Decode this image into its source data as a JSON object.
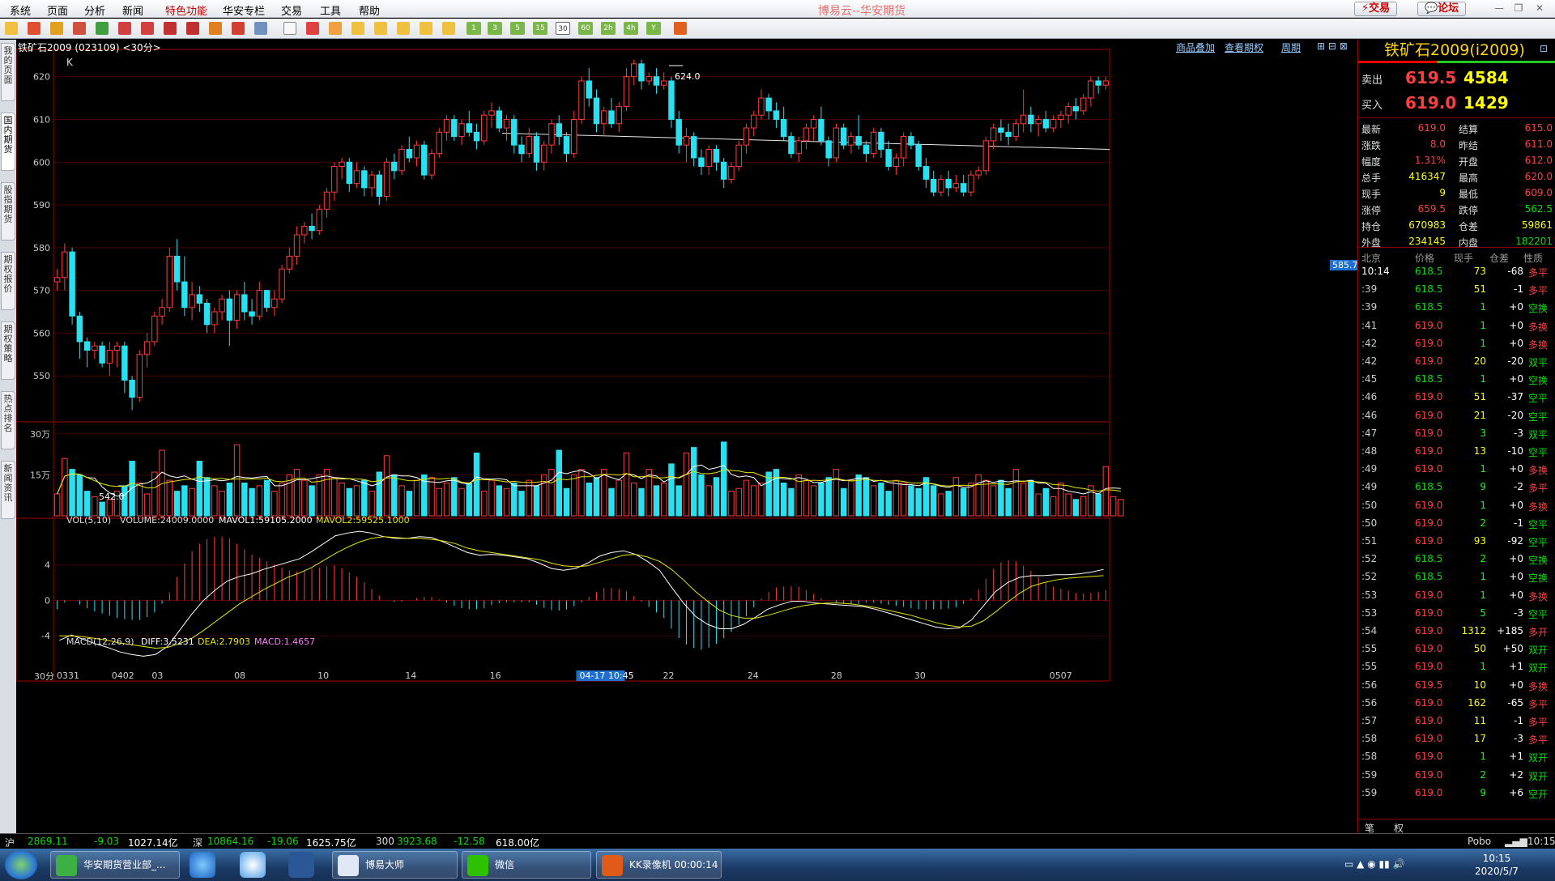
{
  "app": {
    "title": "博易云--华安期货",
    "menu": [
      "系统",
      "页面",
      "分析",
      "新闻",
      "特色功能",
      "华安专栏",
      "交易",
      "工具",
      "帮助"
    ],
    "trade_btn": "⚡交易",
    "forum_btn": "💬论坛"
  },
  "toolbar": {
    "period_buttons": [
      "1",
      "3",
      "5",
      "15",
      "30",
      "60",
      "2h",
      "4h",
      "Y"
    ],
    "selected": "30"
  },
  "sidetabs": [
    "我的页面",
    "国内期货",
    "股指期货",
    "期权报价",
    "期权策略",
    "热点排名",
    "新闻资讯"
  ],
  "chart": {
    "header_left": "铁矿石2009 (023109) <30分>",
    "header_links": [
      "商品叠加",
      "查看期权",
      "周期"
    ],
    "k_label": "K",
    "high_label": "624.0",
    "low_label": "542.0",
    "cursor_price": "585.7",
    "vol_header": {
      "name": "VOL(5,10)",
      "volume": "VOLUME:24009.0000",
      "mavol1": "MAVOL1:59105.2000",
      "mavol2": "MAVOL2:59525.1000"
    },
    "macd_header": {
      "name": "MACD(12,26,9)",
      "diff": "DIFF:3.5231",
      "dea": "DEA:2.7903",
      "macd": "MACD:1.4657"
    },
    "price_ticks": [
      "620",
      "610",
      "600",
      "590",
      "580",
      "570",
      "560",
      "550"
    ],
    "vol_ticks": [
      "30万",
      "15万"
    ],
    "macd_ticks": [
      "4",
      "0",
      "-4"
    ],
    "period_label": "30分",
    "date_labels": [
      "0331",
      "0402",
      "03",
      "08",
      "10",
      "14",
      "16",
      "04-17 10:45",
      "22",
      "24",
      "28",
      "30",
      "0507"
    ],
    "colors": {
      "up": "#ff3b3b",
      "down": "#28e0f0",
      "mavol1": "#ffffff",
      "mavol2": "#e6e600",
      "diff": "#ffffff",
      "dea": "#e6e600"
    }
  },
  "chart_data": {
    "type": "candlestick",
    "title": "铁矿石2009 (023109) <30分>",
    "ylim": [
      540,
      626
    ],
    "trendline": [
      [
        609.5,
        1
      ],
      [
        606,
        76
      ]
    ],
    "candles": [
      [
        572,
        575,
        570,
        573
      ],
      [
        573,
        581,
        570,
        579
      ],
      [
        579,
        580,
        562,
        564
      ],
      [
        564,
        565,
        554,
        558
      ],
      [
        558,
        559,
        552,
        556
      ],
      [
        556,
        558,
        554,
        557
      ],
      [
        557,
        558,
        552,
        553
      ],
      [
        553,
        558,
        550,
        556
      ],
      [
        556,
        558,
        552,
        557
      ],
      [
        557,
        558,
        546,
        549
      ],
      [
        549,
        550,
        542,
        545
      ],
      [
        545,
        556,
        544,
        555
      ],
      [
        555,
        560,
        552,
        558
      ],
      [
        558,
        565,
        557,
        564
      ],
      [
        564,
        568,
        562,
        566
      ],
      [
        566,
        580,
        565,
        578
      ],
      [
        578,
        582,
        570,
        572
      ],
      [
        572,
        578,
        564,
        566
      ],
      [
        566,
        572,
        563,
        569
      ],
      [
        569,
        571,
        565,
        567
      ],
      [
        567,
        568,
        560,
        562
      ],
      [
        562,
        566,
        560,
        565
      ],
      [
        565,
        569,
        563,
        568
      ],
      [
        568,
        570,
        557,
        563
      ],
      [
        563,
        570,
        561,
        569
      ],
      [
        569,
        572,
        563,
        565
      ],
      [
        565,
        568,
        562,
        564
      ],
      [
        564,
        572,
        563,
        570
      ],
      [
        570,
        570,
        565,
        566
      ],
      [
        566,
        570,
        564,
        568
      ],
      [
        568,
        576,
        567,
        575
      ],
      [
        575,
        580,
        574,
        578
      ],
      [
        578,
        585,
        576,
        583
      ],
      [
        583,
        586,
        581,
        585
      ],
      [
        585,
        588,
        582,
        584
      ],
      [
        584,
        590,
        583,
        589
      ],
      [
        589,
        594,
        587,
        593
      ],
      [
        593,
        600,
        591,
        599
      ],
      [
        599,
        601,
        596,
        600
      ],
      [
        600,
        601,
        593,
        595
      ],
      [
        595,
        600,
        594,
        598
      ],
      [
        598,
        599,
        592,
        594
      ],
      [
        594,
        598,
        592,
        597
      ],
      [
        597,
        598,
        590,
        592
      ],
      [
        592,
        601,
        591,
        600
      ],
      [
        600,
        602,
        596,
        598
      ],
      [
        598,
        604,
        597,
        603
      ],
      [
        603,
        606,
        600,
        601
      ],
      [
        601,
        605,
        599,
        604
      ],
      [
        604,
        605,
        596,
        597
      ],
      [
        597,
        603,
        596,
        602
      ],
      [
        602,
        608,
        601,
        607
      ],
      [
        607,
        611,
        605,
        610
      ],
      [
        610,
        611,
        605,
        606
      ],
      [
        606,
        610,
        604,
        609
      ],
      [
        609,
        612,
        606,
        607
      ],
      [
        607,
        609,
        603,
        605
      ],
      [
        605,
        612,
        604,
        611
      ],
      [
        611,
        614,
        608,
        612
      ],
      [
        612,
        613,
        607,
        608
      ],
      [
        608,
        611,
        605,
        610
      ],
      [
        610,
        611,
        602,
        604
      ],
      [
        604,
        606,
        600,
        602
      ],
      [
        602,
        608,
        601,
        606
      ],
      [
        606,
        607,
        598,
        600
      ],
      [
        600,
        605,
        598,
        604
      ],
      [
        604,
        610,
        602,
        609
      ],
      [
        609,
        611,
        604,
        606
      ],
      [
        606,
        607,
        600,
        602
      ],
      [
        602,
        612,
        601,
        610
      ],
      [
        610,
        620,
        609,
        619
      ],
      [
        619,
        622,
        613,
        615
      ],
      [
        615,
        617,
        607,
        609
      ],
      [
        609,
        613,
        606,
        612
      ],
      [
        612,
        615,
        608,
        609
      ],
      [
        609,
        614,
        607,
        613
      ],
      [
        613,
        622,
        612,
        620
      ],
      [
        620,
        624,
        618,
        623
      ],
      [
        623,
        624,
        617,
        619
      ],
      [
        619,
        621,
        618,
        620
      ],
      [
        620,
        622,
        616,
        618
      ],
      [
        618,
        621,
        617,
        619
      ],
      [
        619,
        620,
        608,
        610
      ],
      [
        610,
        612,
        602,
        604
      ],
      [
        604,
        608,
        600,
        606
      ],
      [
        606,
        607,
        599,
        601
      ],
      [
        601,
        603,
        597,
        599
      ],
      [
        599,
        604,
        597,
        603
      ],
      [
        603,
        604,
        598,
        600
      ],
      [
        600,
        601,
        594,
        596
      ],
      [
        596,
        600,
        595,
        599
      ],
      [
        599,
        605,
        598,
        604
      ],
      [
        604,
        609,
        602,
        608
      ],
      [
        608,
        612,
        606,
        611
      ],
      [
        611,
        617,
        610,
        615
      ],
      [
        615,
        616,
        610,
        612
      ],
      [
        612,
        614,
        608,
        610
      ],
      [
        610,
        613,
        605,
        606
      ],
      [
        606,
        607,
        601,
        602
      ],
      [
        602,
        606,
        600,
        605
      ],
      [
        605,
        609,
        603,
        608
      ],
      [
        608,
        611,
        605,
        610
      ],
      [
        610,
        613,
        604,
        605
      ],
      [
        605,
        606,
        599,
        601
      ],
      [
        601,
        609,
        600,
        608
      ],
      [
        608,
        609,
        603,
        604
      ],
      [
        604,
        607,
        602,
        606
      ],
      [
        606,
        611,
        603,
        604
      ],
      [
        604,
        605,
        600,
        602
      ],
      [
        602,
        608,
        601,
        607
      ],
      [
        607,
        608,
        601,
        603
      ],
      [
        603,
        605,
        598,
        599
      ],
      [
        599,
        602,
        597,
        601
      ],
      [
        601,
        607,
        599,
        606
      ],
      [
        606,
        607,
        603,
        604
      ],
      [
        604,
        605,
        598,
        599
      ],
      [
        599,
        601,
        594,
        596
      ],
      [
        596,
        598,
        592,
        593
      ],
      [
        593,
        597,
        592,
        596
      ],
      [
        596,
        598,
        592,
        594
      ],
      [
        594,
        597,
        593,
        595
      ],
      [
        595,
        597,
        592,
        593
      ],
      [
        593,
        598,
        592,
        597
      ],
      [
        597,
        599,
        596,
        598
      ],
      [
        598,
        606,
        597,
        605
      ],
      [
        605,
        609,
        603,
        608
      ],
      [
        608,
        610,
        605,
        607
      ],
      [
        607,
        609,
        604,
        606
      ],
      [
        606,
        610,
        605,
        609
      ],
      [
        609,
        617,
        607,
        611
      ],
      [
        611,
        613,
        607,
        609
      ],
      [
        609,
        611,
        606,
        610
      ],
      [
        610,
        612,
        607,
        608
      ],
      [
        608,
        611,
        607,
        610
      ],
      [
        610,
        612,
        608,
        611
      ],
      [
        611,
        614,
        609,
        613
      ],
      [
        613,
        615,
        610,
        612
      ],
      [
        612,
        616,
        611,
        615
      ],
      [
        615,
        620,
        613,
        619
      ],
      [
        619,
        620,
        616,
        618
      ],
      [
        618,
        620,
        617,
        619
      ]
    ],
    "volume": [
      80,
      210,
      170,
      150,
      90,
      70,
      50,
      60,
      90,
      110,
      200,
      120,
      80,
      160,
      240,
      130,
      90,
      110,
      100,
      200,
      140,
      110,
      90,
      120,
      260,
      120,
      100,
      110,
      130,
      90,
      120,
      150,
      170,
      130,
      110,
      150,
      170,
      140,
      120,
      100,
      110,
      130,
      90,
      160,
      220,
      150,
      110,
      90,
      130,
      150,
      140,
      100,
      120,
      140,
      100,
      120,
      230,
      90,
      130,
      110,
      100,
      120,
      90,
      130,
      110,
      150,
      170,
      240,
      100,
      150,
      170,
      120,
      140,
      170,
      100,
      130,
      230,
      120,
      100,
      170,
      110,
      120,
      190,
      110,
      230,
      250,
      150,
      110,
      140,
      270,
      90,
      100,
      130,
      110,
      120,
      160,
      170,
      120,
      100,
      150,
      130,
      110,
      120,
      140,
      170,
      100,
      130,
      150,
      140,
      110,
      120,
      90,
      130,
      120,
      110,
      100,
      140,
      110,
      80,
      90,
      140,
      100,
      120,
      150,
      130,
      110,
      130,
      100,
      170,
      120,
      130,
      80,
      100,
      70,
      120,
      80,
      60,
      70,
      110,
      80,
      180,
      70,
      60
    ],
    "diff": [
      -4.5,
      -3.9,
      -4.4,
      -4.9,
      -5.3,
      -5.8,
      -6.1,
      -6.3,
      -6.1,
      -5.2,
      -3.4,
      -1.6,
      0.0,
      1.2,
      2.2,
      2.7,
      3.0,
      3.5,
      3.9,
      4.3,
      4.7,
      5.5,
      6.4,
      7.3,
      7.6,
      7.8,
      7.6,
      7.2,
      7.0,
      7.0,
      7.2,
      7.1,
      6.6,
      6.0,
      5.4,
      5.1,
      5.2,
      5.1,
      4.9,
      4.7,
      4.2,
      3.6,
      3.4,
      3.6,
      4.2,
      5.0,
      5.4,
      5.6,
      5.2,
      4.4,
      3.4,
      1.5,
      -0.3,
      -1.8,
      -2.7,
      -3.2,
      -3.2,
      -2.7,
      -1.9,
      -1.0,
      -0.5,
      -0.1,
      -0.1,
      -0.3,
      -0.4,
      -0.5,
      -0.6,
      -0.7,
      -1.0,
      -1.4,
      -1.8,
      -2.2,
      -2.6,
      -3.0,
      -3.2,
      -3.1,
      -2.2,
      -0.6,
      1.0,
      2.0,
      2.6,
      2.8,
      2.8,
      2.9,
      2.9,
      3.0,
      3.2,
      3.5
    ],
    "dea": [
      -4.0,
      -4.0,
      -4.1,
      -4.3,
      -4.5,
      -4.8,
      -5.0,
      -5.2,
      -5.4,
      -5.3,
      -4.9,
      -4.3,
      -3.4,
      -2.4,
      -1.4,
      -0.4,
      0.4,
      1.2,
      1.9,
      2.6,
      3.1,
      3.7,
      4.5,
      5.3,
      6.0,
      6.6,
      7.0,
      7.2,
      7.1,
      7.0,
      7.0,
      6.9,
      6.7,
      6.4,
      5.9,
      5.6,
      5.4,
      5.2,
      5.0,
      4.8,
      4.6,
      4.2,
      3.9,
      3.8,
      3.9,
      4.3,
      4.7,
      5.1,
      5.2,
      4.9,
      4.4,
      3.5,
      2.3,
      1.0,
      -0.1,
      -1.1,
      -1.7,
      -2.0,
      -2.0,
      -1.7,
      -1.3,
      -0.9,
      -0.6,
      -0.4,
      -0.3,
      -0.3,
      -0.4,
      -0.6,
      -0.8,
      -1.1,
      -1.4,
      -1.7,
      -2.1,
      -2.5,
      -2.8,
      -3.0,
      -2.9,
      -2.3,
      -1.3,
      -0.2,
      0.8,
      1.6,
      2.0,
      2.3,
      2.5,
      2.6,
      2.7,
      2.8
    ]
  },
  "quote": {
    "title": "铁矿石2009(i2009)",
    "ask_label": "卖出",
    "ask_price": "619.5",
    "ask_vol": "4584",
    "bid_label": "买入",
    "bid_price": "619.0",
    "bid_vol": "1429",
    "fields": [
      {
        "l1": "最新",
        "v1": "619.0",
        "l2": "结算",
        "v2": "615.0"
      },
      {
        "l1": "涨跌",
        "v1": "8.0",
        "l2": "昨结",
        "v2": "611.0"
      },
      {
        "l1": "幅度",
        "v1": "1.31%",
        "l2": "开盘",
        "v2": "612.0"
      },
      {
        "l1": "总手",
        "v1": "416347",
        "l2": "最高",
        "v2": "620.0"
      },
      {
        "l1": "现手",
        "v1": "9",
        "l2": "最低",
        "v2": "609.0"
      },
      {
        "l1": "涨停",
        "v1": "659.5",
        "l2": "跌停",
        "v2": "562.5"
      },
      {
        "l1": "持仓",
        "v1": "670983",
        "l2": "仓差",
        "v2": "59861"
      },
      {
        "l1": "外盘",
        "v1": "234145",
        "l2": "内盘",
        "v2": "182201"
      }
    ],
    "tick_header": [
      "北京",
      "价格",
      "现手",
      "仓差",
      "性质"
    ],
    "ticks": [
      [
        "10:14",
        "618.5",
        "73",
        "-68",
        "多平"
      ],
      [
        ":39",
        "618.5",
        "51",
        "-1",
        "多平"
      ],
      [
        ":39",
        "618.5",
        "1",
        "+0",
        "空换"
      ],
      [
        ":41",
        "619.0",
        "1",
        "+0",
        "多换"
      ],
      [
        ":42",
        "619.0",
        "1",
        "+0",
        "多换"
      ],
      [
        ":42",
        "619.0",
        "20",
        "-20",
        "双平"
      ],
      [
        ":45",
        "618.5",
        "1",
        "+0",
        "空换"
      ],
      [
        ":46",
        "619.0",
        "51",
        "-37",
        "空平"
      ],
      [
        ":46",
        "619.0",
        "21",
        "-20",
        "空平"
      ],
      [
        ":47",
        "619.0",
        "3",
        "-3",
        "双平"
      ],
      [
        ":48",
        "619.0",
        "13",
        "-10",
        "空平"
      ],
      [
        ":49",
        "619.0",
        "1",
        "+0",
        "多换"
      ],
      [
        ":49",
        "618.5",
        "9",
        "-2",
        "多平"
      ],
      [
        ":50",
        "619.0",
        "1",
        "+0",
        "多换"
      ],
      [
        ":50",
        "619.0",
        "2",
        "-1",
        "空平"
      ],
      [
        ":51",
        "619.0",
        "93",
        "-92",
        "空平"
      ],
      [
        ":52",
        "618.5",
        "2",
        "+0",
        "空换"
      ],
      [
        ":52",
        "618.5",
        "1",
        "+0",
        "空换"
      ],
      [
        ":53",
        "619.0",
        "1",
        "+0",
        "多换"
      ],
      [
        ":53",
        "619.0",
        "5",
        "-3",
        "空平"
      ],
      [
        ":54",
        "619.0",
        "1312",
        "+185",
        "多开"
      ],
      [
        ":55",
        "619.0",
        "50",
        "+50",
        "双开"
      ],
      [
        ":55",
        "619.0",
        "1",
        "+1",
        "双开"
      ],
      [
        ":56",
        "619.5",
        "10",
        "+0",
        "多换"
      ],
      [
        ":56",
        "619.0",
        "162",
        "-65",
        "多平"
      ],
      [
        ":57",
        "619.0",
        "11",
        "-1",
        "多平"
      ],
      [
        ":58",
        "619.0",
        "17",
        "-3",
        "多平"
      ],
      [
        ":58",
        "619.0",
        "1",
        "+1",
        "双开"
      ],
      [
        ":59",
        "619.0",
        "2",
        "+2",
        "双开"
      ],
      [
        ":59",
        "619.0",
        "9",
        "+6",
        "空开"
      ]
    ],
    "bottom_tabs": [
      "笔",
      "权"
    ]
  },
  "status": {
    "sh_label": "沪",
    "sh_val": "2869.11",
    "sh_chg": "-9.03",
    "sh_amt": "1027.14亿",
    "sz_label": "深",
    "sz_val": "10864.16",
    "sz_chg": "-19.06",
    "sz_amt": "1625.75亿",
    "hs_label": "300",
    "hs_val": "3923.68",
    "hs_chg": "-12.58",
    "hs_amt": "618.00亿",
    "right": "Pobo",
    "time": "10:15"
  },
  "taskbar": {
    "tasks": [
      "华安期货营业部_...",
      "博易大师",
      "微信",
      "KK录像机 00:00:14"
    ],
    "clock_time": "10:15",
    "clock_date": "2020/5/7"
  }
}
